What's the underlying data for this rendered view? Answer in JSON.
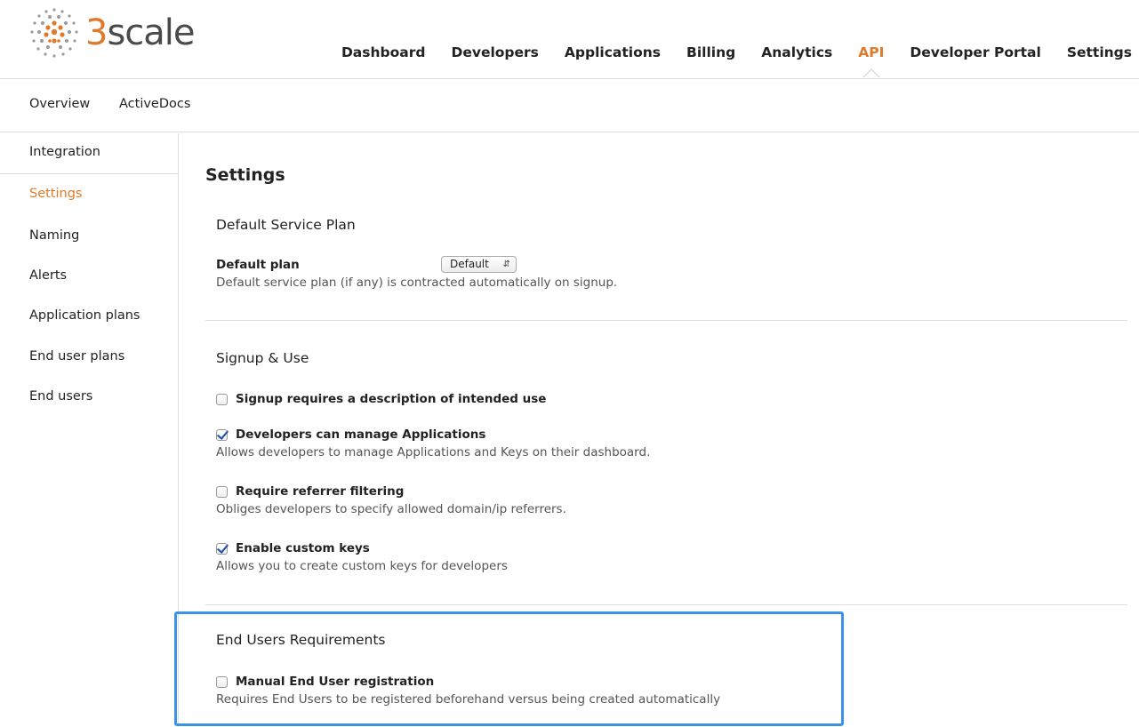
{
  "logo": {
    "prefix": "3",
    "word": "scale"
  },
  "colors": {
    "accent": "#e07a2a",
    "highlight": "#3a93e8",
    "checkmark": "#1f4fa8"
  },
  "topnav": [
    {
      "label": "Dashboard",
      "active": false
    },
    {
      "label": "Developers",
      "active": false
    },
    {
      "label": "Applications",
      "active": false
    },
    {
      "label": "Billing",
      "active": false
    },
    {
      "label": "Analytics",
      "active": false
    },
    {
      "label": "API",
      "active": true
    },
    {
      "label": "Developer Portal",
      "active": false
    },
    {
      "label": "Settings",
      "active": false
    }
  ],
  "subnav": [
    {
      "label": "Overview"
    },
    {
      "label": "ActiveDocs"
    }
  ],
  "sidebar": [
    {
      "label": "Integration",
      "active": false
    },
    {
      "label": "Settings",
      "active": true
    },
    {
      "label": "Naming",
      "active": false
    },
    {
      "label": "Alerts",
      "active": false
    },
    {
      "label": "Application plans",
      "active": false
    },
    {
      "label": "End user plans",
      "active": false
    },
    {
      "label": "End users",
      "active": false
    }
  ],
  "main": {
    "title": "Settings",
    "default_service_plan": {
      "heading": "Default Service Plan",
      "field_label": "Default plan",
      "selected": "Default",
      "hint": "Default service plan (if any) is contracted automatically on signup."
    },
    "signup_use": {
      "heading": "Signup & Use",
      "options": [
        {
          "label": "Signup requires a description of intended use",
          "checked": false,
          "hint": ""
        },
        {
          "label": "Developers can manage Applications",
          "checked": true,
          "hint": "Allows developers to manage Applications and Keys on their dashboard."
        },
        {
          "label": "Require referrer filtering",
          "checked": false,
          "hint": "Obliges developers to specify allowed domain/ip referrers."
        },
        {
          "label": "Enable custom keys",
          "checked": true,
          "hint": "Allows you to create custom keys for developers"
        }
      ]
    },
    "end_users": {
      "heading": "End Users Requirements",
      "option": {
        "label": "Manual End User registration",
        "checked": false,
        "hint": "Requires End Users to be registered beforehand versus being created automatically"
      }
    }
  }
}
